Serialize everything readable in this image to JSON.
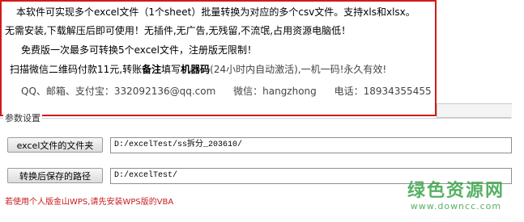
{
  "notice": {
    "line1": "本软件可实现多个excel文件（1个sheet）批量转换为对应的多个csv文件。支持xls和xlsx。",
    "line2": "无需安装,下载解压后即可使用！无插件,无广告,无残留,不流氓,占用资源电脑低！",
    "line3": "免费版一次最多可转换5个excel文件，注册版无限制！",
    "line4_a": "扫描微信二维码付款11元,转账",
    "line4_b": "备注",
    "line4_c": "填写",
    "line4_d": "机器码",
    "line4_e": "(24小时内自动激活),一机一码!永久有效!",
    "contact_qq_label": "QQ、邮箱、支付宝：332092136@qq.com",
    "contact_wechat_label": "微信：hangzhong",
    "contact_phone_label": "电话：18934355455"
  },
  "section": {
    "label": "参数设置"
  },
  "excel_folder": {
    "button_label": "excel文件的文件夹",
    "value": "D:/excelTest/ss拆分_203610/"
  },
  "output_path": {
    "button_label": "转换后保存的路径",
    "value": "D:/excelTest/"
  },
  "wps_note": "若使用个人版金山WPS,请先安装WPS版的VBA",
  "watermark": {
    "big": "绿色资源网",
    "small": "www.downcc.com"
  },
  "colors": {
    "border_red": "#d21a1a",
    "note_red": "#c81a1a",
    "watermark_green": "#3aa449"
  }
}
